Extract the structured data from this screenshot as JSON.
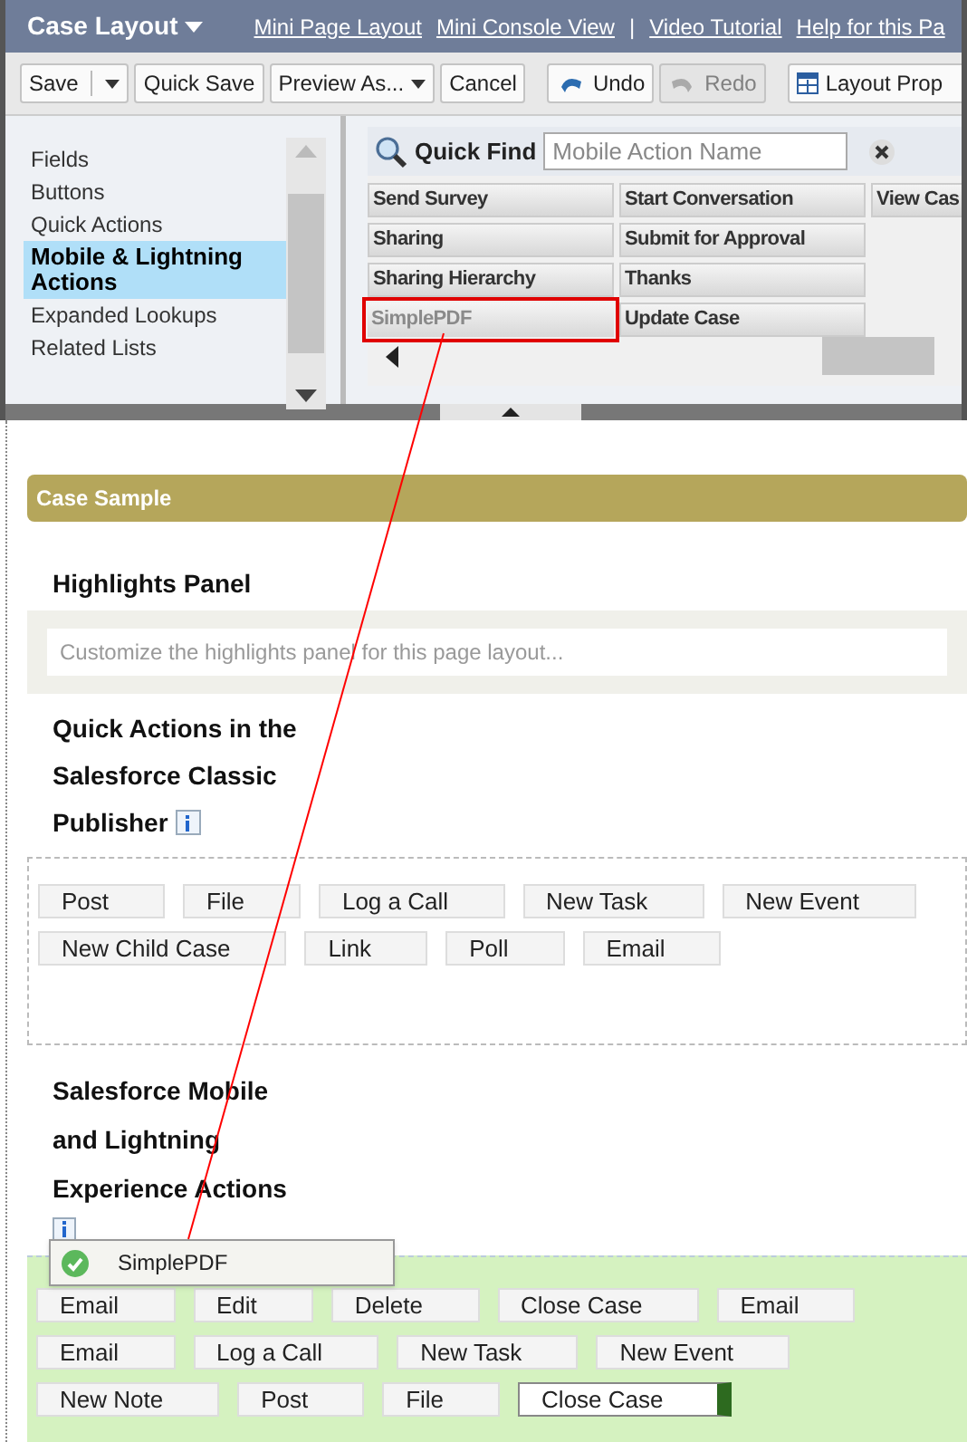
{
  "header": {
    "title": "Case Layout",
    "links": [
      "Mini Page Layout",
      "Mini Console View",
      "|",
      "Video Tutorial",
      "Help for this Pa"
    ]
  },
  "toolbar": [
    {
      "kind": "split",
      "label": "Save",
      "disabled": false
    },
    {
      "kind": "button",
      "label": "Quick Save",
      "disabled": false
    },
    {
      "kind": "dropdown",
      "label": "Preview As...",
      "disabled": false
    },
    {
      "kind": "button",
      "label": "Cancel",
      "disabled": false
    },
    {
      "kind": "undo",
      "label": "Undo",
      "disabled": false
    },
    {
      "kind": "redo",
      "label": "Redo",
      "disabled": true
    },
    {
      "kind": "layout",
      "label": "Layout Prop",
      "disabled": false
    }
  ],
  "palette": {
    "categories": [
      {
        "label": "Fields",
        "selected": false
      },
      {
        "label": "Buttons",
        "selected": false
      },
      {
        "label": "Quick Actions",
        "selected": false
      },
      {
        "label": "Mobile & Lightning Actions",
        "selected": true
      },
      {
        "label": "Expanded Lookups",
        "selected": false
      },
      {
        "label": "Related Lists",
        "selected": false
      }
    ],
    "quick_find": {
      "label": "Quick Find",
      "placeholder": "Mobile Action Name"
    },
    "items": [
      {
        "label": "Send Survey",
        "disabled": false,
        "highlighted": false
      },
      {
        "label": "Start Conversation",
        "disabled": false,
        "highlighted": false
      },
      {
        "label": "View Cas",
        "disabled": false,
        "highlighted": false
      },
      {
        "label": "Sharing",
        "disabled": false,
        "highlighted": false
      },
      {
        "label": "Submit for Approval",
        "disabled": false,
        "highlighted": false
      },
      {
        "label": "Sharing Hierarchy",
        "disabled": false,
        "highlighted": false
      },
      {
        "label": "Thanks",
        "disabled": false,
        "highlighted": false
      },
      {
        "label": "SimplePDF",
        "disabled": true,
        "highlighted": true
      },
      {
        "label": "Update Case",
        "disabled": false,
        "highlighted": false
      }
    ]
  },
  "section": {
    "title": "Case Sample",
    "highlights": {
      "title": "Highlights Panel",
      "placeholder": "Customize the highlights panel for this page layout..."
    },
    "classic_publisher": {
      "title": [
        "Quick Actions in the",
        "Salesforce Classic",
        "Publisher"
      ],
      "actions": [
        "Post",
        "File",
        "Log a Call",
        "New Task",
        "New Event",
        "New Child Case",
        "Link",
        "Poll",
        "Email"
      ]
    },
    "mobile_actions": {
      "title": [
        "Salesforce Mobile",
        "and Lightning",
        "Experience Actions"
      ],
      "actions": [
        {
          "label": "Email",
          "selected": false
        },
        {
          "label": "Edit",
          "selected": false
        },
        {
          "label": "Delete",
          "selected": false
        },
        {
          "label": "Close Case",
          "selected": false
        },
        {
          "label": "Email",
          "selected": false
        },
        {
          "label": "Email",
          "selected": false
        },
        {
          "label": "Log a Call",
          "selected": false
        },
        {
          "label": "New Task",
          "selected": false
        },
        {
          "label": "New Event",
          "selected": false
        },
        {
          "label": "New Note",
          "selected": false
        },
        {
          "label": "Post",
          "selected": false
        },
        {
          "label": "File",
          "selected": false
        },
        {
          "label": "Close Case",
          "selected": true
        }
      ]
    }
  },
  "drag_item": {
    "label": "SimplePDF"
  }
}
